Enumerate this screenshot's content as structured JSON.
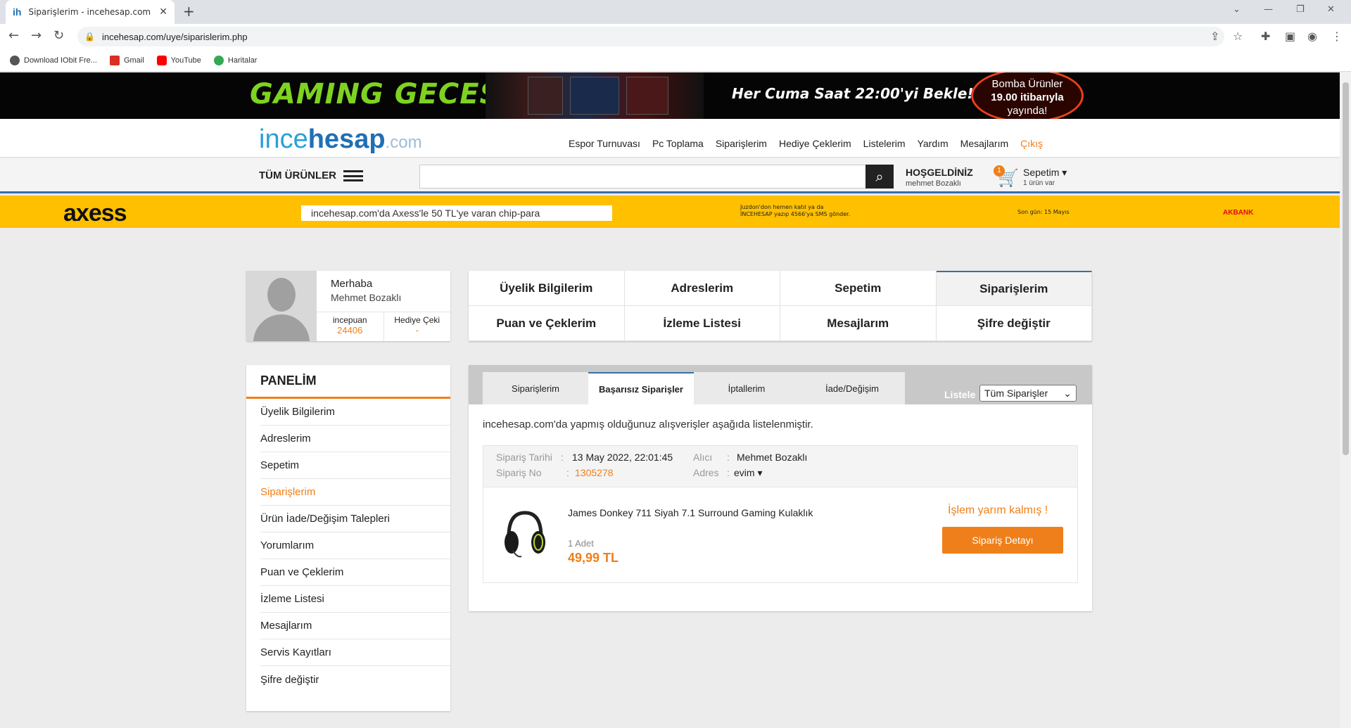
{
  "browser": {
    "tab_title": "Siparişlerim - incehesap.com",
    "tab_favicon": "ih",
    "url": "incehesap.com/uye/siparislerim.php",
    "bookmarks": [
      {
        "label": "Download IObit Fre...",
        "icon": "iobit-icon",
        "color": "#555555"
      },
      {
        "label": "Gmail",
        "icon": "gmail-icon",
        "color": "#d93025"
      },
      {
        "label": "YouTube",
        "icon": "youtube-icon",
        "color": "#ff0000"
      },
      {
        "label": "Haritalar",
        "icon": "maps-icon",
        "color": "#34a853"
      }
    ]
  },
  "promo_banner": {
    "title": "GAMING GECESİ",
    "tagline": "Her Cuma Saat 22:00'yi Bekle!",
    "badge_line1": "Bomba Ürünler",
    "badge_line2": "19.00 itibarıyla",
    "badge_line3": "yayında!"
  },
  "header": {
    "logo_ince": "ince",
    "logo_hesap": "hesap",
    "logo_com": ".com",
    "nav": [
      "Espor Turnuvası",
      "Pc Toplama",
      "Siparişlerim",
      "Hediye Çeklerim",
      "Listelerim",
      "Yardım",
      "Mesajlarım"
    ],
    "logout": "Çıkış"
  },
  "searchbar": {
    "all_products": "TÜM ÜRÜNLER",
    "search_placeholder": "",
    "welcome": "HOŞGELDİNİZ",
    "welcome_user": "mehmet Bozaklı",
    "cart_count": "1",
    "cart_label": "Sepetim",
    "cart_sub": "1 ürün var"
  },
  "axess_banner": {
    "logo": "axess",
    "text": "incehesap.com'da Axess'le 50 TL'ye varan chip-para",
    "sms_line1": "Juzdon'don hemen katıl ya da",
    "sms_line2": "İNCEHESAP yazıp 4566'ya SMS gönder.",
    "last_day": "Son gün: 15 Mayıs",
    "bank": "AKBANK"
  },
  "profile": {
    "greeting": "Merhaba",
    "name": "Mehmet Bozaklı",
    "points_label": "incepuan",
    "points_value": "24406",
    "gift_label": "Hediye Çeki",
    "gift_value": "-"
  },
  "account_grid": [
    "Üyelik Bilgilerim",
    "Adreslerim",
    "Sepetim",
    "Siparişlerim",
    "Puan ve Çeklerim",
    "İzleme Listesi",
    "Mesajlarım",
    "Şifre değiştir"
  ],
  "panel": {
    "title": "PANELİM",
    "items": [
      "Üyelik Bilgilerim",
      "Adreslerim",
      "Sepetim",
      "Siparişlerim",
      "Ürün İade/Değişim Talepleri",
      "Yorumlarım",
      "Puan ve Çeklerim",
      "İzleme Listesi",
      "Mesajlarım",
      "Servis Kayıtları",
      "Şifre değiştir"
    ],
    "active_index": 3
  },
  "orders": {
    "tabs": [
      "Siparişlerim",
      "Başarısız Siparişler",
      "İptallerim",
      "İade/Değişim"
    ],
    "active_tab": 1,
    "list_label": "Listele",
    "filter_value": "Tüm Siparişler",
    "intro": "incehesap.com'da yapmış olduğunuz alışverişler aşağıda listelenmiştir.",
    "order_date_label": "Sipariş Tarihi",
    "order_date": "13 May 2022, 22:01:45",
    "order_no_label": "Sipariş No",
    "order_no": "1305278",
    "recipient_label": "Alıcı",
    "recipient": "Mehmet Bozaklı",
    "address_label": "Adres",
    "address": "evim",
    "item_name": "James Donkey 711 Siyah 7.1 Surround Gaming Kulaklık",
    "item_qty": "1 Adet",
    "item_price": "49,99 TL",
    "status": "İşlem yarım kalmış !",
    "detail_button": "Sipariş Detayı"
  },
  "colors": {
    "accent": "#ef7f1a",
    "blue": "#1f6fb5",
    "axess": "#ffc000"
  }
}
